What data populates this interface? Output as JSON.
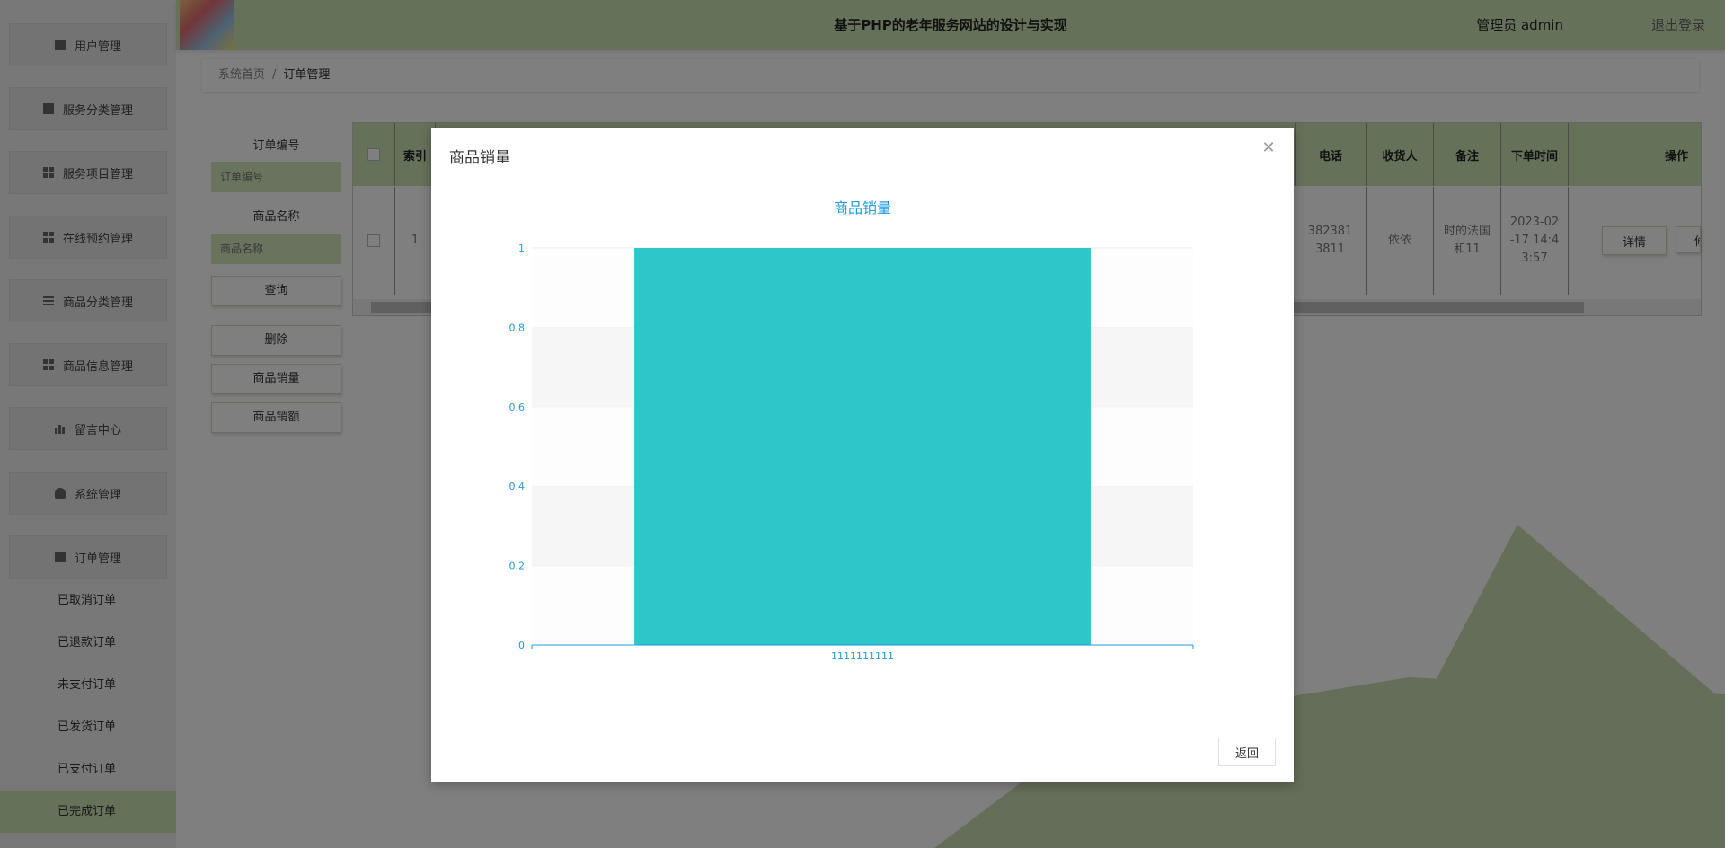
{
  "header": {
    "title": "基于PHP的老年服务网站的设计与实现",
    "user": "管理员 admin",
    "logout": "退出登录"
  },
  "sidebar": {
    "items": [
      {
        "label": "用户管理",
        "icon": "clipboard-icon"
      },
      {
        "label": "服务分类管理",
        "icon": "monitor-icon"
      },
      {
        "label": "服务项目管理",
        "icon": "grid-icon"
      },
      {
        "label": "在线预约管理",
        "icon": "grid-icon"
      },
      {
        "label": "商品分类管理",
        "icon": "list-icon"
      },
      {
        "label": "商品信息管理",
        "icon": "grid-icon"
      },
      {
        "label": "留言中心",
        "icon": "bar-chart-icon"
      },
      {
        "label": "系统管理",
        "icon": "user-icon"
      },
      {
        "label": "订单管理",
        "icon": "monitor-icon"
      }
    ],
    "sub_items": [
      "已取消订单",
      "已退款订单",
      "未支付订单",
      "已发货订单",
      "已支付订单",
      "已完成订单"
    ],
    "active_sub": "已完成订单"
  },
  "breadcrumb": {
    "home": "系统首页",
    "sep": "/",
    "current": "订单管理"
  },
  "filters": {
    "order_no_label": "订单编号",
    "order_no_placeholder": "订单编号",
    "goods_name_label": "商品名称",
    "goods_name_placeholder": "商品名称",
    "query_btn": "查询",
    "delete_btn": "删除",
    "sales_qty_btn": "商品销量",
    "sales_amount_btn": "商品销额"
  },
  "table": {
    "headers": {
      "index": "索引",
      "phone": "电话",
      "receiver": "收货人",
      "remark": "备注",
      "order_time": "下单时间",
      "ops": "操作"
    },
    "row": {
      "index": "1",
      "phone_1": "382381",
      "phone_2": "3811",
      "receiver": "依依",
      "remark_1": "时的法国",
      "remark_2": "和11",
      "time_1": "2023-02",
      "time_2": "-17 14:4",
      "time_3": "3:57",
      "detail_btn": "详情",
      "edit_btn_partial": "修"
    }
  },
  "modal": {
    "title": "商品销量",
    "return_btn": "返回"
  },
  "colors": {
    "accent": "#cde3b5",
    "bar": "#2ec7c9",
    "axis_text": "#1e9adb"
  },
  "chart_data": {
    "type": "bar",
    "title": "商品销量",
    "categories": [
      "1111111111"
    ],
    "values": [
      1
    ],
    "ylim": [
      0,
      1
    ],
    "yticks": [
      "0",
      "0.2",
      "0.4",
      "0.6",
      "0.8",
      "1"
    ],
    "grid": true
  }
}
